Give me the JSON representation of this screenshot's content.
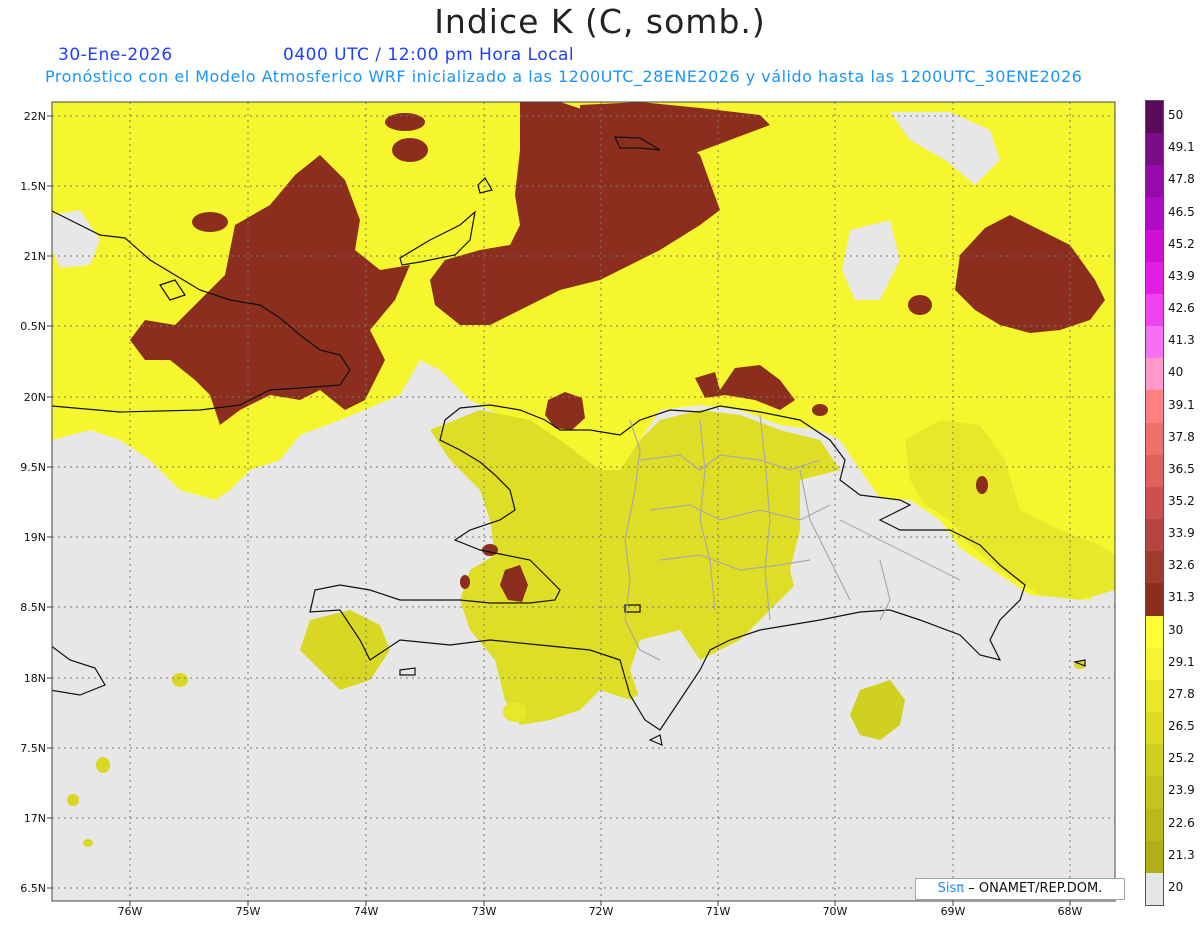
{
  "header": {
    "title": "Indice K (C, somb.)",
    "date": "30-Ene-2026",
    "time": "0400 UTC / 12:00 pm Hora Local",
    "subtitle": "Pronóstico con el Modelo Atmosferico WRF inicializado a las 1200UTC_28ENE2026 y válido hasta las  1200UTC_30ENE2026"
  },
  "axes": {
    "lat_labels": [
      "22N",
      "1.5N",
      "21N",
      "0.5N",
      "20N",
      "9.5N",
      "19N",
      "8.5N",
      "18N",
      "7.5N",
      "17N",
      "6.5N"
    ],
    "lon_labels": [
      "76W",
      "75W",
      "74W",
      "73W",
      "72W",
      "71W",
      "70W",
      "69W",
      "68W"
    ]
  },
  "colorbar": {
    "levels": [
      "50",
      "49.1",
      "47.8",
      "46.5",
      "45.2",
      "43.9",
      "42.6",
      "41.3",
      "40",
      "39.1",
      "37.8",
      "36.5",
      "35.2",
      "33.9",
      "32.6",
      "31.3",
      "30",
      "29.1",
      "27.8",
      "26.5",
      "25.2",
      "23.9",
      "22.6",
      "21.3",
      "20"
    ],
    "colors": [
      "#5a0a5a",
      "#7a0c86",
      "#950aa8",
      "#b10ac4",
      "#cf10d8",
      "#e21ee6",
      "#f043f0",
      "#f570f2",
      "#ff99cc",
      "#ff8080",
      "#f07070",
      "#e06060",
      "#cc5050",
      "#b54540",
      "#9e3a30",
      "#8b2e1e",
      "#ffff33",
      "#f4f430",
      "#e8e82a",
      "#dcdc24",
      "#cfcf20",
      "#c4c41c",
      "#baba18",
      "#b0b016",
      "#e6e6e6"
    ]
  },
  "credit": {
    "brand": "Sisπ",
    "text": "– ONAMET/REP.DOM."
  }
}
